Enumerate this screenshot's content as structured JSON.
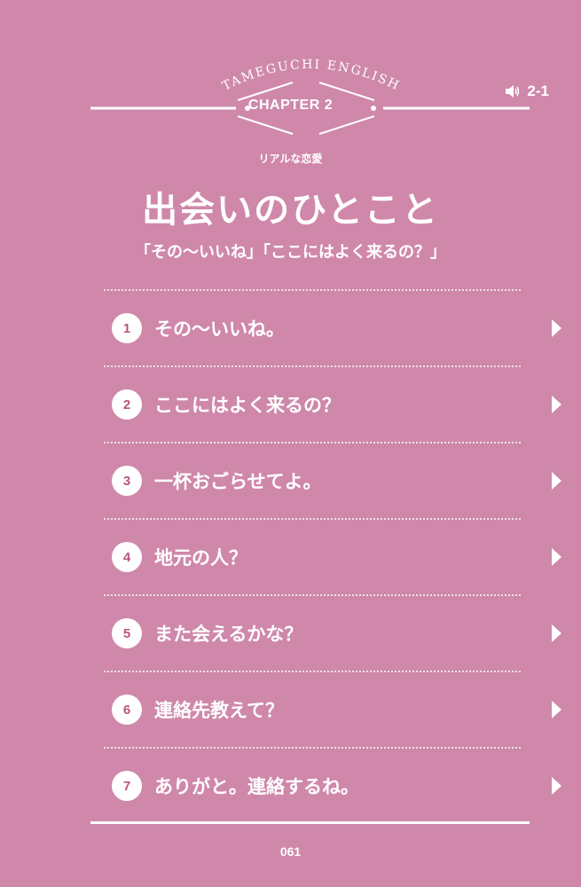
{
  "header": {
    "series_name": "TAMEGUCHI ENGLISH",
    "chapter_label": "CHAPTER 2",
    "audio_icon": "speaker-icon",
    "track": "2-1"
  },
  "section": {
    "category": "リアルな恋愛",
    "title": "出会いのひとこと",
    "subtitle": "「その〜いいね」「ここにはよく来るの？」"
  },
  "phrases": [
    {
      "number": "1",
      "text": "その〜いいね。"
    },
    {
      "number": "2",
      "text": "ここにはよく来るの？"
    },
    {
      "number": "3",
      "text": "一杯おごらせてよ。"
    },
    {
      "number": "4",
      "text": "地元の人？"
    },
    {
      "number": "5",
      "text": "また会えるかな？"
    },
    {
      "number": "6",
      "text": "連絡先教えて？"
    },
    {
      "number": "7",
      "text": "ありがと。連絡するね。"
    }
  ],
  "footer": {
    "page_number": "061"
  },
  "colors": {
    "background": "#cf88aa",
    "foreground": "#ffffff",
    "number_text": "#b9557f"
  }
}
